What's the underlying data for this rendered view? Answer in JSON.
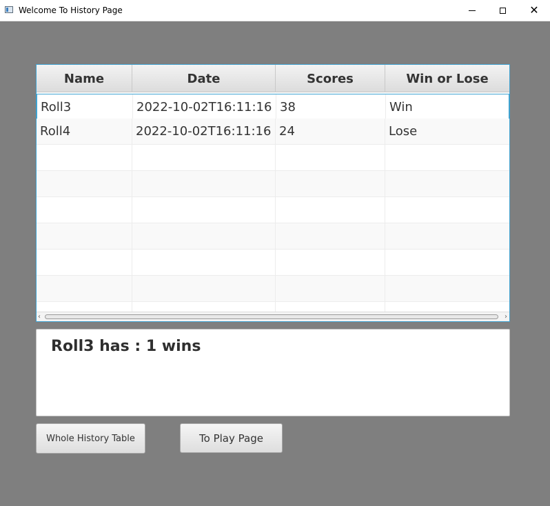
{
  "window": {
    "title": "Welcome To History Page",
    "controls": [
      "minimize",
      "maximize",
      "close"
    ]
  },
  "table": {
    "columns": [
      "Name",
      "Date",
      "Scores",
      "Win or Lose"
    ],
    "rows": [
      [
        "Roll3",
        "2022-10-02T16:11:16",
        "38",
        "Win"
      ],
      [
        "Roll4",
        "2022-10-02T16:11:16",
        "24",
        "Lose"
      ]
    ],
    "selected_row": 0
  },
  "summary": {
    "text": "Roll3 has : 1 wins"
  },
  "buttons": {
    "whole_history": "Whole History Table",
    "to_play": "To Play Page"
  },
  "colors": {
    "background": "#7f7f7f",
    "focus_accent": "#3ea2d1"
  }
}
